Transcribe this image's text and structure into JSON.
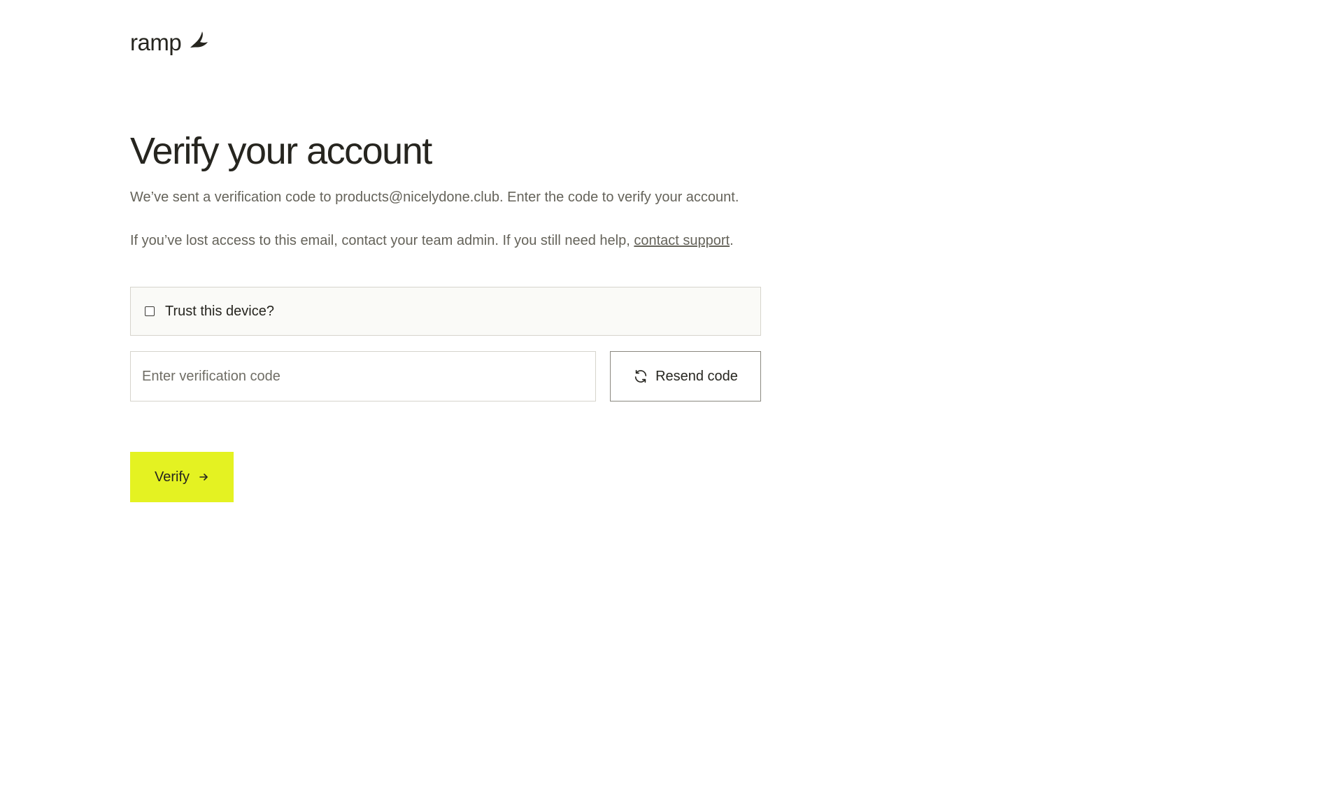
{
  "brand": {
    "name": "ramp",
    "logo_icon": "ramp-logo-icon"
  },
  "main": {
    "title": "Verify your account",
    "message_sent": "We’ve sent a verification code to products@nicelydone.club. Enter the code to verify your account.",
    "help_text": "If you’ve lost access to this email, contact your team admin. If you still need help, ",
    "help_link": "contact support",
    "help_suffix": "."
  },
  "trust_device": {
    "label": "Trust this device?",
    "checked": false
  },
  "verification": {
    "placeholder": "Enter verification code",
    "value": ""
  },
  "resend": {
    "label": "Resend code",
    "icon": "refresh-icon"
  },
  "verify": {
    "label": "Verify",
    "icon": "arrow-right-icon"
  },
  "colors": {
    "accent": "#e4f222",
    "text": "#26251f",
    "muted_text": "#65635a",
    "border": "#d6d4cc"
  }
}
